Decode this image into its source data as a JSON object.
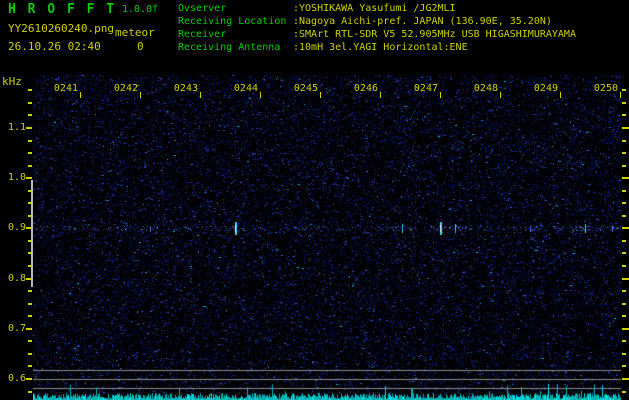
{
  "header": {
    "app_title": "H R O F F T",
    "version": "1.0.0f",
    "filename": "YY2610260240.png",
    "mode": "meteor",
    "datetime": "26.10.26 02:40",
    "count": "0",
    "info": [
      {
        "label": "Ovserver",
        "value": ":YOSHIKAWA Yasufumi /JG2MLI"
      },
      {
        "label": "Receiving Location",
        "value": ":Nagoya Aichi-pref. JAPAN (136.90E, 35.20N)"
      },
      {
        "label": "Receiver",
        "value": ":SMArt RTL-SDR V5 52.905MHz USB HIGASHIMURAYAMA"
      },
      {
        "label": "Receiving Antenna",
        "value": ":10mH 3el.YAGI Horizontal:ENE"
      }
    ]
  },
  "spectrogram": {
    "y_axis_unit": "kHz",
    "freq_ticks": [
      "1.1",
      "1.0",
      "0.9",
      "0.8",
      "0.7",
      "0.6"
    ],
    "freq_minor_step_khz": 0.025,
    "freq_range_khz": [
      0.575,
      1.175
    ],
    "time_ticks": [
      "0241",
      "0242",
      "0243",
      "0244",
      "0245",
      "0246",
      "0247",
      "0248",
      "0249",
      "0250"
    ],
    "carrier_freq_khz": 0.9,
    "echoes": [
      {
        "t_min": 2.17,
        "strength": "faint"
      },
      {
        "t_min": 3.58,
        "strength": "strong"
      },
      {
        "t_min": 6.37,
        "strength": "medium"
      },
      {
        "t_min": 7.0,
        "strength": "strong"
      },
      {
        "t_min": 7.25,
        "strength": "medium"
      },
      {
        "t_min": 8.5,
        "strength": "faint"
      },
      {
        "t_min": 9.42,
        "strength": "medium"
      },
      {
        "t_min": 9.87,
        "strength": "faint"
      }
    ]
  },
  "colors": {
    "green": "#00cc00",
    "yellow": "#d0d000",
    "gray_line": "#8c8c8c",
    "cal_line": "#b8b8b8",
    "trace": "#00b4b4",
    "trace_bright": "#00e0e0",
    "echo_cyan": "#49d8ee",
    "echo_core": "#d8ffff",
    "carrier_dot": "#28409a",
    "carrier_bright": "#5a78dc",
    "noise_palette": [
      "#000a28",
      "#001048",
      "#0a1a6e",
      "#14288c",
      "#2840b4",
      "#4060d2",
      "#00b4dc"
    ]
  }
}
